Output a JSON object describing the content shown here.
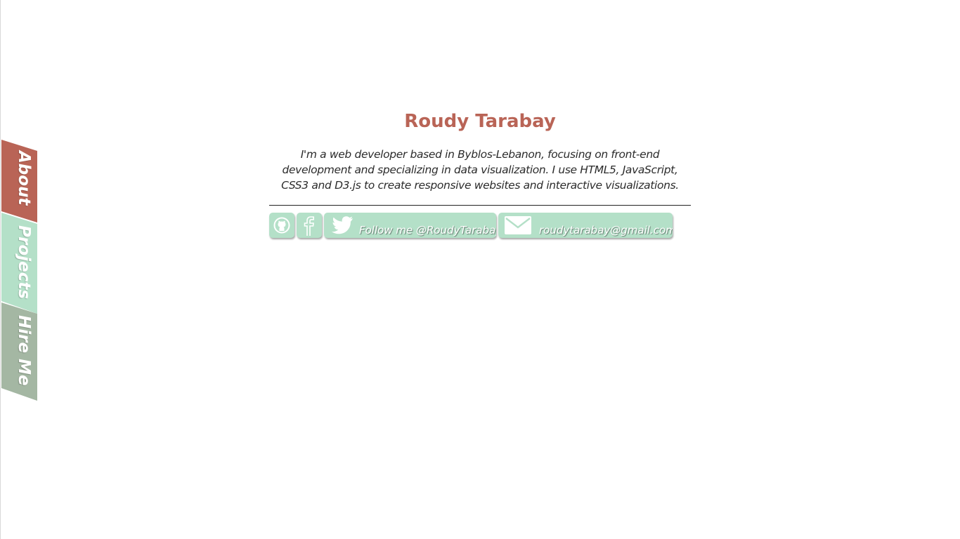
{
  "side_nav": {
    "items": [
      {
        "label": "About",
        "color": "#b96456"
      },
      {
        "label": "Projects",
        "color": "#b4e0c8"
      },
      {
        "label": "Hire Me",
        "color": "#a4b7a3"
      }
    ]
  },
  "profile": {
    "name": "Roudy Tarabay",
    "bio": "I'm a web developer based in Byblos-Lebanon, focusing on front-end development and specializing in data visualization. I use HTML5, JavaScript, CSS3 and D3.js to create responsive websites and interactive visualizations."
  },
  "socials": {
    "github_icon": "github-icon",
    "facebook_icon": "facebook-icon",
    "twitter_label": "Follow me @RoudyTarabay",
    "email_label": "roudytarabay@gmail.com"
  },
  "colors": {
    "accent": "#b96456",
    "button": "#b4e0c8",
    "muted": "#a4b7a3"
  }
}
